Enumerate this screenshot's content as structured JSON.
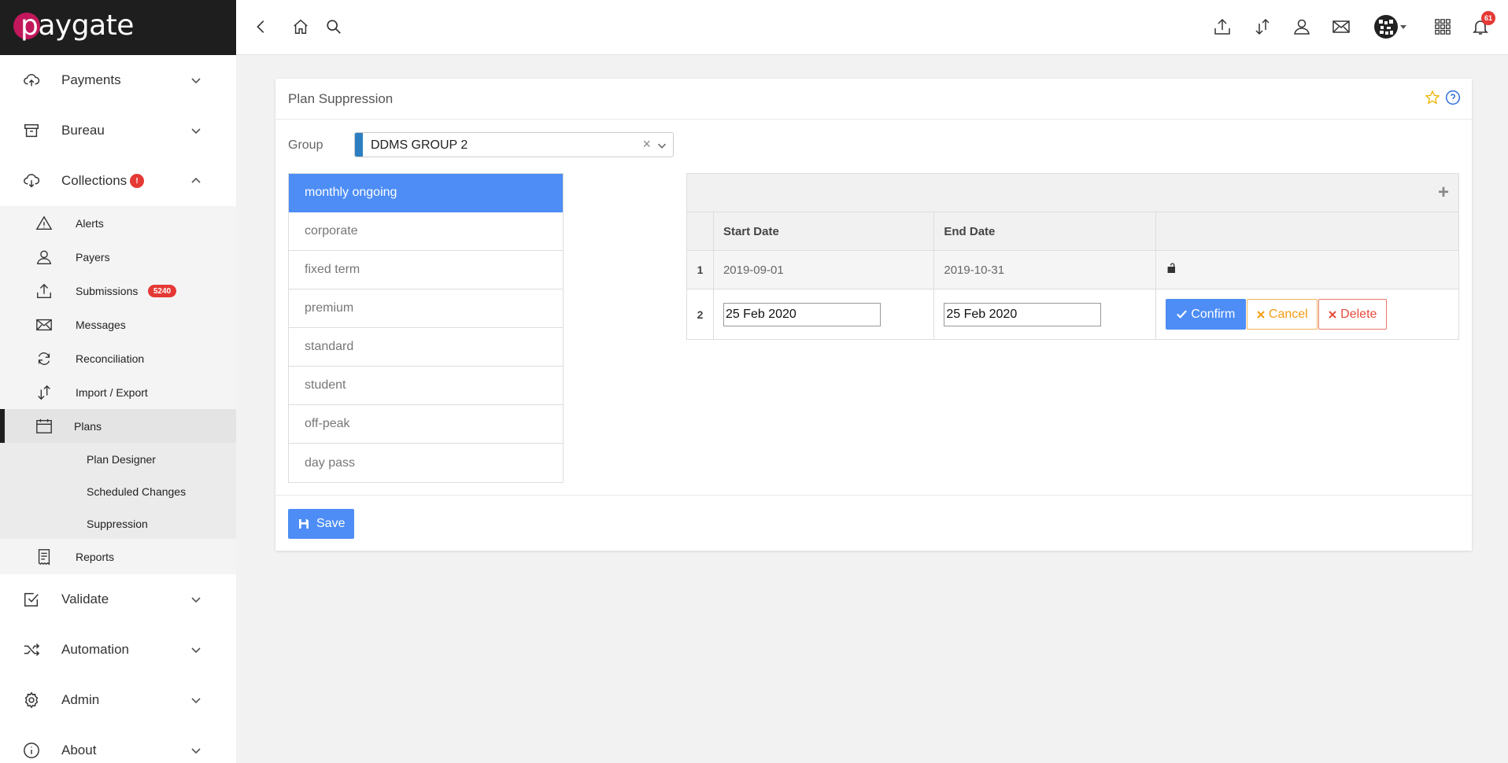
{
  "app": {
    "brand": "paygate"
  },
  "sidebar": {
    "sections": [
      {
        "label": "Payments",
        "icon": "cloud-upload-icon"
      },
      {
        "label": "Bureau",
        "icon": "archive-icon"
      },
      {
        "label": "Collections",
        "icon": "cloud-download-icon",
        "badge": "!"
      },
      {
        "label": "Validate",
        "icon": "checkbox-icon"
      },
      {
        "label": "Automation",
        "icon": "shuffle-icon"
      },
      {
        "label": "Admin",
        "icon": "gear-icon"
      },
      {
        "label": "About",
        "icon": "info-icon"
      }
    ],
    "collections_items": [
      {
        "label": "Alerts",
        "icon": "warning-icon"
      },
      {
        "label": "Payers",
        "icon": "user-icon"
      },
      {
        "label": "Submissions",
        "icon": "upload-icon",
        "badge": "5240"
      },
      {
        "label": "Messages",
        "icon": "envelope-icon"
      },
      {
        "label": "Reconciliation",
        "icon": "sync-icon"
      },
      {
        "label": "Import / Export",
        "icon": "transfer-icon"
      },
      {
        "label": "Plans",
        "icon": "calendar-icon"
      },
      {
        "label": "Reports",
        "icon": "receipt-icon"
      }
    ],
    "plans_items": [
      {
        "label": "Plan Designer"
      },
      {
        "label": "Scheduled Changes"
      },
      {
        "label": "Suppression"
      }
    ]
  },
  "topbar": {
    "notification_count": "61"
  },
  "page": {
    "title": "Plan Suppression",
    "group_label": "Group",
    "group_value": "DDMS GROUP 2",
    "plans": [
      "monthly ongoing",
      "corporate",
      "fixed term",
      "premium",
      "standard",
      "student",
      "off-peak",
      "day pass"
    ],
    "grid": {
      "headers": [
        "Start Date",
        "End Date"
      ],
      "rows": [
        {
          "num": "1",
          "start": "2019-09-01",
          "end": "2019-10-31"
        },
        {
          "num": "2",
          "start": "25 Feb 2020",
          "end": "25 Feb 2020"
        }
      ],
      "confirm_label": "Confirm",
      "cancel_label": "Cancel",
      "delete_label": "Delete"
    },
    "save_label": "Save"
  },
  "colors": {
    "accent": "#4d8df5",
    "sidebar_header": "#1e1e1e",
    "badge": "#e53935",
    "logo": "#c2185b"
  }
}
